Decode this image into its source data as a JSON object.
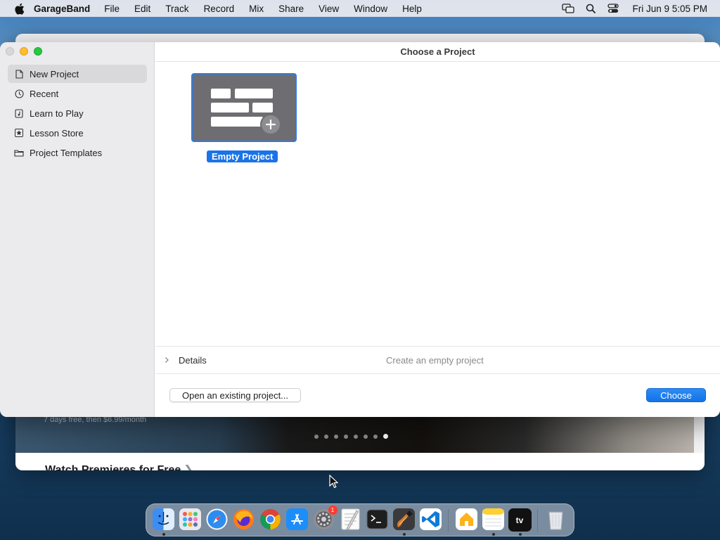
{
  "menubar": {
    "app_name": "GarageBand",
    "menus": [
      "File",
      "Edit",
      "Track",
      "Record",
      "Mix",
      "Share",
      "View",
      "Window",
      "Help"
    ],
    "clock": "Fri Jun 9  5:05 PM",
    "icons": [
      "apple-icon",
      "screen-mirroring-icon",
      "spotlight-search-icon",
      "control-center-icon"
    ]
  },
  "dialog": {
    "title": "Choose a Project",
    "sidebar": {
      "items": [
        {
          "label": "New Project",
          "icon": "document-icon",
          "selected": true
        },
        {
          "label": "Recent",
          "icon": "clock-icon",
          "selected": false
        },
        {
          "label": "Learn to Play",
          "icon": "music-note-icon",
          "selected": false
        },
        {
          "label": "Lesson Store",
          "icon": "star-icon",
          "selected": false
        },
        {
          "label": "Project Templates",
          "icon": "folder-icon",
          "selected": false
        }
      ]
    },
    "project": {
      "label": "Empty Project",
      "icon": "add-icon"
    },
    "details": {
      "label": "Details",
      "description": "Create an empty project"
    },
    "buttons": {
      "open_existing": "Open an existing project...",
      "choose": "Choose"
    },
    "colors": {
      "accent": "#1a73e8",
      "tile": "#6e6e72"
    }
  },
  "background_window": {
    "offer_text": "7 days free, then $6.99/month",
    "heading": "Watch Premieres for Free",
    "carousel_pages": 8,
    "carousel_active": 8
  },
  "dock": {
    "apps": [
      {
        "name": "Finder",
        "icon": "finder-icon",
        "running": true
      },
      {
        "name": "Launchpad",
        "icon": "launchpad-icon",
        "running": false
      },
      {
        "name": "Safari",
        "icon": "safari-icon",
        "running": false
      },
      {
        "name": "Firefox",
        "icon": "firefox-icon",
        "running": false
      },
      {
        "name": "Chrome",
        "icon": "chrome-icon",
        "running": false
      },
      {
        "name": "App Store",
        "icon": "app-store-icon",
        "running": false
      },
      {
        "name": "System Settings",
        "icon": "settings-icon",
        "running": false,
        "badge": "1"
      },
      {
        "name": "TextEdit",
        "icon": "textedit-icon",
        "running": false
      },
      {
        "name": "Terminal",
        "icon": "terminal-icon",
        "running": false
      },
      {
        "name": "GarageBand",
        "icon": "garageband-icon",
        "running": true
      },
      {
        "name": "VS Code",
        "icon": "vscode-icon",
        "running": false
      },
      {
        "name": "Home",
        "icon": "home-icon",
        "running": false
      },
      {
        "name": "Notes",
        "icon": "notes-icon",
        "running": true
      },
      {
        "name": "TV",
        "icon": "apple-tv-icon",
        "label": "tv",
        "running": true
      },
      {
        "name": "Trash",
        "icon": "trash-icon",
        "running": false
      }
    ]
  }
}
